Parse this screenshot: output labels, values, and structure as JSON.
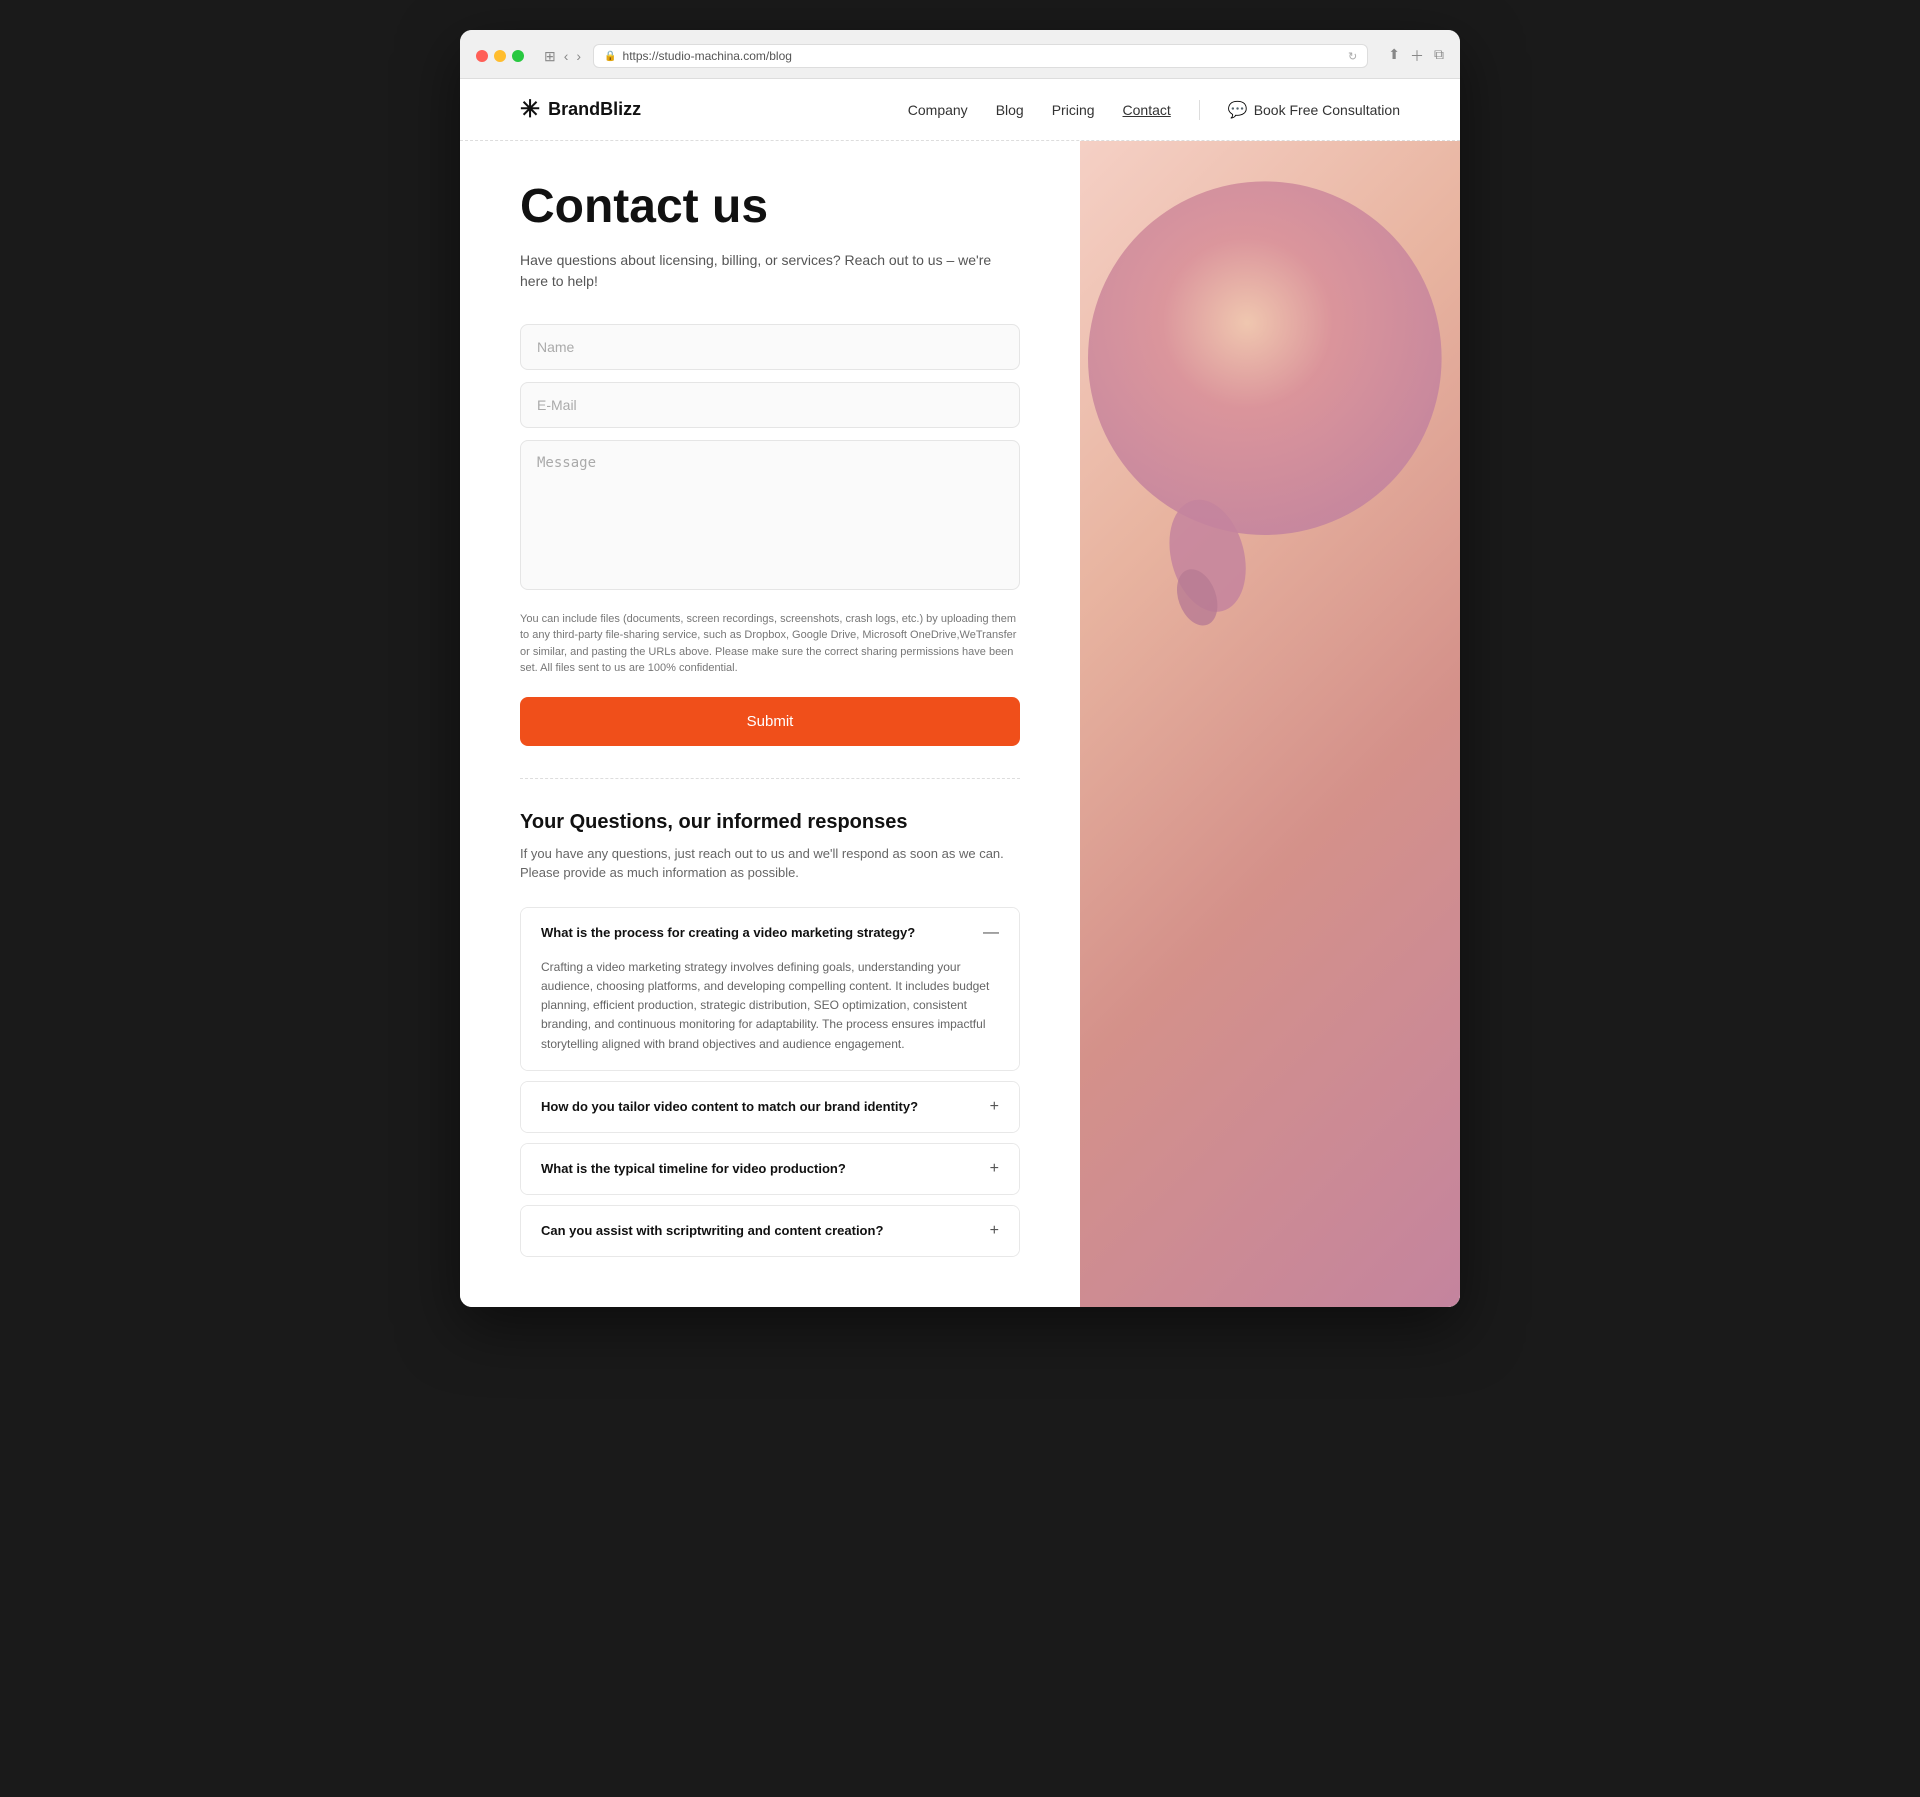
{
  "browser": {
    "url": "https://studio-machina.com/blog",
    "tl_red": "#ff5f57",
    "tl_yellow": "#ffbd2e",
    "tl_green": "#28c840"
  },
  "navbar": {
    "logo_text": "BrandBlizz",
    "nav_items": [
      {
        "label": "Company",
        "active": false
      },
      {
        "label": "Blog",
        "active": false
      },
      {
        "label": "Pricing",
        "active": false
      },
      {
        "label": "Contact",
        "active": true
      }
    ],
    "cta_label": "Book Free Consultation"
  },
  "contact": {
    "title": "Contact us",
    "subtitle": "Have questions about licensing, billing, or services? Reach out to us – we're here to help!",
    "form": {
      "name_placeholder": "Name",
      "email_placeholder": "E-Mail",
      "message_placeholder": "Message",
      "file_note": "You can include files (documents, screen recordings, screenshots, crash logs, etc.) by uploading them to any third-party file-sharing service, such as Dropbox, Google Drive, Microsoft OneDrive,WeTransfer or similar, and pasting the URLs above. Please make sure the correct sharing permissions have been set. All files sent to us are 100% confidential.",
      "submit_label": "Submit"
    }
  },
  "faq": {
    "title": "Your Questions, our informed responses",
    "subtitle": "If you have any questions, just reach out to us and we'll respond as soon as we can. Please provide as much information as possible.",
    "items": [
      {
        "question": "What is the process for creating a video marketing strategy?",
        "answer": "Crafting a video marketing strategy involves defining goals, understanding your audience, choosing platforms, and developing compelling content. It includes budget planning, efficient production, strategic distribution, SEO optimization, consistent branding, and continuous monitoring for adaptability. The process ensures impactful storytelling aligned with brand objectives and audience engagement.",
        "open": true
      },
      {
        "question": "How do you tailor video content to match our brand identity?",
        "answer": "",
        "open": false
      },
      {
        "question": "What is the typical timeline for video production?",
        "answer": "",
        "open": false
      },
      {
        "question": "Can you assist with scriptwriting and content creation?",
        "answer": "",
        "open": false
      }
    ]
  }
}
